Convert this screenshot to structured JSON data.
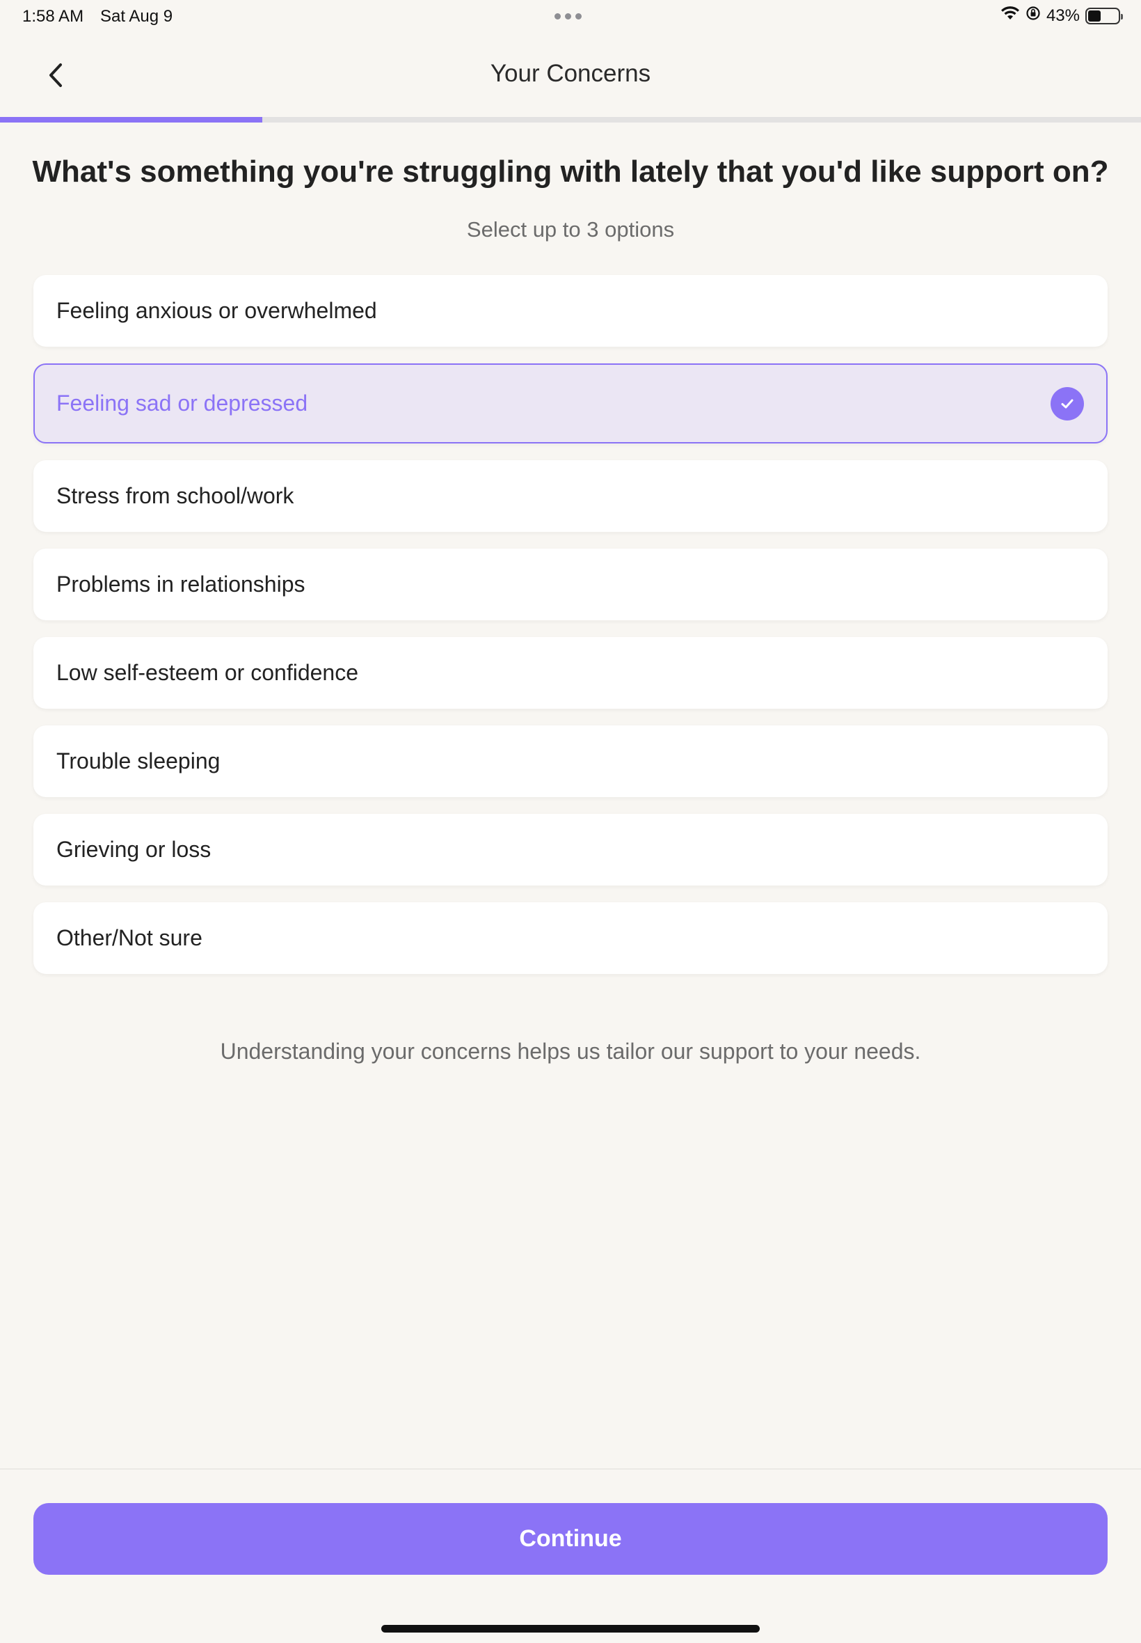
{
  "status_bar": {
    "time": "1:58 AM",
    "date": "Sat Aug 9",
    "battery_text": "43%",
    "battery_level": 0.43,
    "icons": [
      "wifi-icon",
      "orientation-lock-icon",
      "battery-icon"
    ]
  },
  "header": {
    "title": "Your Concerns",
    "back_icon": "chevron-left-icon"
  },
  "progress": {
    "value": 0.23
  },
  "question": {
    "title": "What's something you're struggling with lately that you'd like support on?",
    "subtitle": "Select up to 3 options"
  },
  "options": [
    {
      "label": "Feeling anxious or overwhelmed",
      "selected": false
    },
    {
      "label": "Feeling sad or depressed",
      "selected": true
    },
    {
      "label": "Stress from school/work",
      "selected": false
    },
    {
      "label": "Problems in relationships",
      "selected": false
    },
    {
      "label": "Low self-esteem or confidence",
      "selected": false
    },
    {
      "label": "Trouble sleeping",
      "selected": false
    },
    {
      "label": "Grieving or loss",
      "selected": false
    },
    {
      "label": "Other/Not sure",
      "selected": false
    }
  ],
  "footer_note": "Understanding your concerns helps us tailor our support to your needs.",
  "continue_label": "Continue",
  "colors": {
    "accent": "#8b73f6",
    "selected_bg": "#ebe6f4",
    "background": "#f8f6f2"
  }
}
